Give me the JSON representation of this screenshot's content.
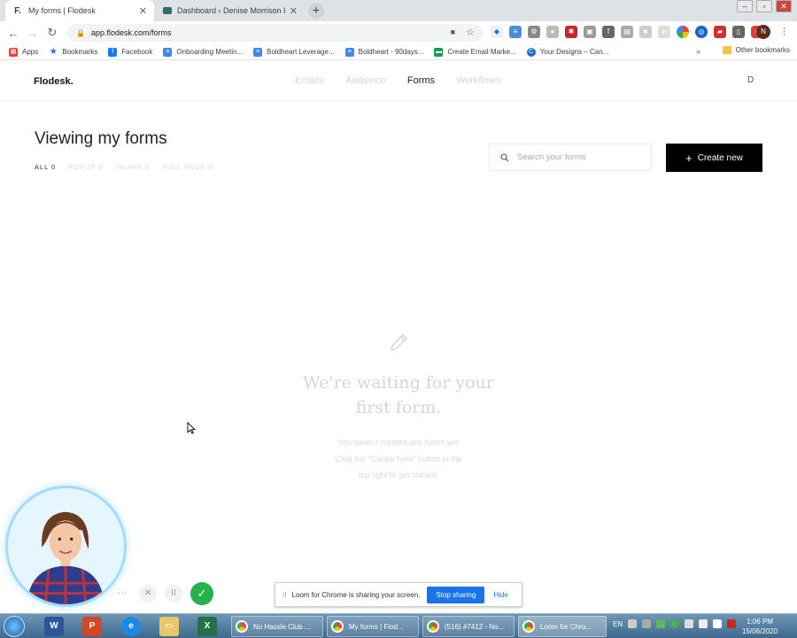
{
  "browser": {
    "tabs": [
      {
        "title": "My forms | Flodesk",
        "favicon": "F.",
        "active": true
      },
      {
        "title": "Dashboard ‹ Denise Morrison Int",
        "favicon": "",
        "active": false
      }
    ],
    "new_tab": "+",
    "window_controls": [
      "–",
      "▫",
      "✕"
    ],
    "url": "app.flodesk.com/forms",
    "profile_initial": "N",
    "bookmarks": [
      {
        "label": "Apps",
        "icon": "apps-grid",
        "color": "#e94235"
      },
      {
        "label": "Bookmarks",
        "icon": "star",
        "color": "#1a73e8"
      },
      {
        "label": "Facebook",
        "icon": "facebook",
        "color": "#1877f2"
      },
      {
        "label": "Onboarding Meetin...",
        "icon": "doc",
        "color": "#4285f4"
      },
      {
        "label": "Boldheart Leverage...",
        "icon": "doc",
        "color": "#4285f4"
      },
      {
        "label": "Boldheart - 90days...",
        "icon": "doc",
        "color": "#4285f4"
      },
      {
        "label": "Create Email Marke...",
        "icon": "chat",
        "color": "#0f9d58"
      },
      {
        "label": "Your Designs – Can...",
        "icon": "canva",
        "color": "#1f6fd6"
      }
    ],
    "bookmarks_more": "»",
    "other_bookmarks": "Other bookmarks"
  },
  "app": {
    "brand": "Flodesk.",
    "nav": [
      {
        "label": "Emails",
        "active": false
      },
      {
        "label": "Audience",
        "active": false
      },
      {
        "label": "Forms",
        "active": true
      },
      {
        "label": "Workflows",
        "active": false
      }
    ],
    "user_initial": "D",
    "page_title": "Viewing my forms",
    "filters": [
      {
        "label": "ALL 0",
        "active": true
      },
      {
        "label": "POPUP 0",
        "active": false
      },
      {
        "label": "INLINE 0",
        "active": false
      },
      {
        "label": "FULL PAGE 0",
        "active": false
      }
    ],
    "search_placeholder": "Search your forms",
    "create_button": "Create new",
    "create_plus": "+",
    "empty_title_line1": "We're waiting for your",
    "empty_title_line2": "first form.",
    "empty_sub_line1": "You haven't created any forms yet.",
    "empty_sub_line2": "Click the \"Create New\" button in the",
    "empty_sub_line3": "top right to get started."
  },
  "loom": {
    "controls": [
      "···",
      "✕",
      "II",
      "✓"
    ],
    "share_message": "Loom for Chrome is sharing your screen.",
    "stop_label": "Stop sharing",
    "hide_label": "Hide",
    "grip": "II"
  },
  "taskbar": {
    "apps": [
      {
        "label": "No Hassle Club ..."
      },
      {
        "label": "My forms | Flod..."
      },
      {
        "label": "(516) #7412 - No..."
      },
      {
        "label": "Loom for Chro..."
      }
    ],
    "language": "EN",
    "time": "1:06 PM",
    "date": "15/06/2020"
  },
  "colors": {
    "accent_blue": "#1a73e8",
    "button_black": "#000000",
    "loom_green": "#26b24a"
  }
}
